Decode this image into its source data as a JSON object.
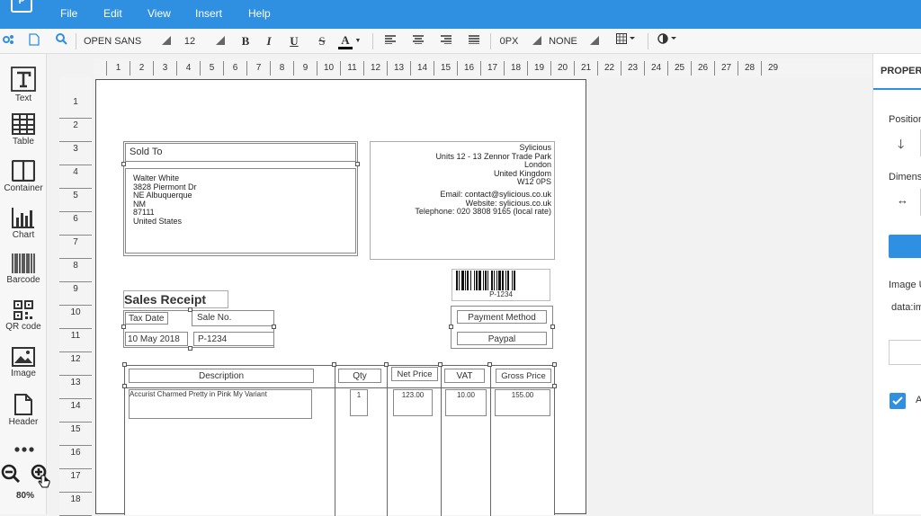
{
  "menubar": {
    "items": [
      "File",
      "Edit",
      "View",
      "Insert",
      "Help"
    ]
  },
  "toolbar": {
    "font_family": "OPEN SANS",
    "font_size": "12",
    "bold": "B",
    "italic": "I",
    "underline": "U",
    "strike": "S",
    "color_letter": "A",
    "border_width": "0PX",
    "border_style": "NONE"
  },
  "toolbox": {
    "items": [
      "Text",
      "Table",
      "Container",
      "Chart",
      "Barcode",
      "QR code",
      "Image",
      "Header"
    ],
    "zoom": "80%"
  },
  "rulers": {
    "horizontal": [
      "1",
      "2",
      "3",
      "4",
      "5",
      "6",
      "7",
      "8",
      "9",
      "10",
      "11",
      "12",
      "13",
      "14",
      "15",
      "16",
      "17",
      "18",
      "19",
      "20",
      "21",
      "22",
      "23",
      "24",
      "25",
      "26",
      "27",
      "28",
      "29"
    ],
    "vertical": [
      "1",
      "2",
      "3",
      "4",
      "5",
      "6",
      "7",
      "8",
      "9",
      "10",
      "11",
      "12",
      "13",
      "14",
      "15",
      "16",
      "17",
      "18"
    ]
  },
  "document": {
    "sold_to_label": "Sold To",
    "customer": [
      "Walter White",
      "3828 Piermont Dr",
      "NE Albuquerque",
      "NM",
      "87111",
      "United States"
    ],
    "company": [
      "Sylicious",
      "Units 12 - 13 Zennor Trade Park",
      "London",
      "United Kingdom",
      "W12 0PS",
      "",
      "Email: contact@sylicious.co.uk",
      "Website: sylicious.co.uk",
      "Telephone: 020 3808 9165 (local rate)"
    ],
    "barcode_text": "P-1234",
    "title": "Sales Receipt",
    "tax_date_label": "Tax Date",
    "tax_date_value": "10 May 2018",
    "sale_no_label": "Sale No.",
    "sale_no_value": "P-1234",
    "payment_method_label": "Payment Method",
    "payment_method_value": "Paypal",
    "table_headers": [
      "Description",
      "Qty",
      "Net Price",
      "VAT",
      "Gross Price"
    ],
    "table_row": [
      "Accurist Charmed Pretty in Pink My Variant",
      "1",
      "123.00",
      "10.00",
      "155.00"
    ]
  },
  "properties_panel": {
    "title": "PROPERT",
    "position_label": "Position",
    "dimensions_label": "Dimens",
    "image_url_label": "Image U",
    "image_url_value": "data:im",
    "checkbox_label": "A"
  },
  "colors": {
    "accent": "#2f8fe0",
    "menubar": "#2f8fe0"
  }
}
